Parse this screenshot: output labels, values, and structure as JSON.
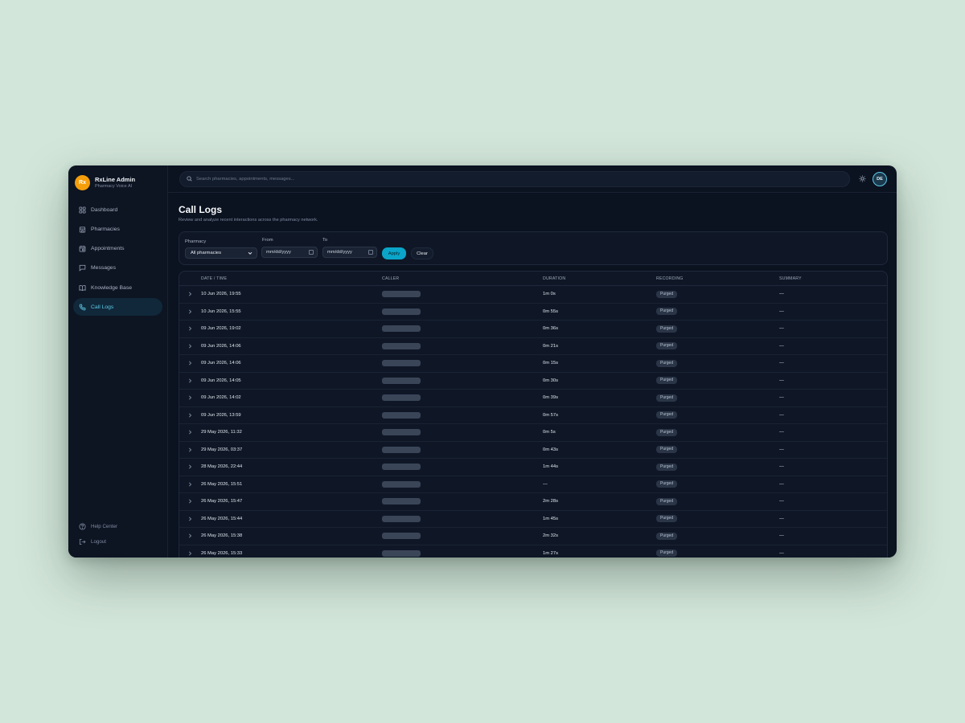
{
  "brand": {
    "logo": "Rx",
    "name": "RxLine Admin",
    "subtitle": "Pharmacy Voice AI"
  },
  "nav": [
    {
      "label": "Dashboard",
      "icon": "grid-icon",
      "active": false
    },
    {
      "label": "Pharmacies",
      "icon": "building-icon",
      "active": false
    },
    {
      "label": "Appointments",
      "icon": "calendar-icon",
      "active": false
    },
    {
      "label": "Messages",
      "icon": "message-icon",
      "active": false
    },
    {
      "label": "Knowledge Base",
      "icon": "book-icon",
      "active": false
    },
    {
      "label": "Call Logs",
      "icon": "phone-icon",
      "active": true
    }
  ],
  "nav_bottom": [
    {
      "label": "Help Center",
      "icon": "help-icon"
    },
    {
      "label": "Logout",
      "icon": "logout-icon"
    }
  ],
  "topbar": {
    "search_placeholder": "Search pharmacies, appointments, messages...",
    "avatar": "DE"
  },
  "page": {
    "title": "Call Logs",
    "subtitle": "Review and analyze recent interactions across the pharmacy network."
  },
  "filters": {
    "pharmacy_label": "Pharmacy",
    "pharmacy_value": "All pharmacies",
    "from_label": "From",
    "from_value": "mm/dd/yyyy",
    "to_label": "To",
    "to_value": "mm/dd/yyyy",
    "apply_label": "Apply",
    "clear_label": "Clear"
  },
  "table": {
    "columns": [
      "DATE / TIME",
      "CALLER",
      "DURATION",
      "RECORDING",
      "SUMMARY"
    ],
    "rows": [
      {
        "date": "10 Jun 2026, 19:55",
        "duration": "1m 0s",
        "recording": "Purged",
        "summary": "—"
      },
      {
        "date": "10 Jun 2026, 15:55",
        "duration": "0m 55s",
        "recording": "Purged",
        "summary": "—"
      },
      {
        "date": "09 Jun 2026, 19:02",
        "duration": "0m 36s",
        "recording": "Purged",
        "summary": "—"
      },
      {
        "date": "09 Jun 2026, 14:06",
        "duration": "0m 21s",
        "recording": "Purged",
        "summary": "—"
      },
      {
        "date": "09 Jun 2026, 14:06",
        "duration": "0m 15s",
        "recording": "Purged",
        "summary": "—"
      },
      {
        "date": "09 Jun 2026, 14:05",
        "duration": "0m 30s",
        "recording": "Purged",
        "summary": "—"
      },
      {
        "date": "09 Jun 2026, 14:02",
        "duration": "0m 39s",
        "recording": "Purged",
        "summary": "—"
      },
      {
        "date": "09 Jun 2026, 13:59",
        "duration": "0m 57s",
        "recording": "Purged",
        "summary": "—"
      },
      {
        "date": "29 May 2026, 11:32",
        "duration": "0m 5s",
        "recording": "Purged",
        "summary": "—"
      },
      {
        "date": "29 May 2026, 03:37",
        "duration": "0m 43s",
        "recording": "Purged",
        "summary": "—"
      },
      {
        "date": "28 May 2026, 22:44",
        "duration": "1m 44s",
        "recording": "Purged",
        "summary": "—"
      },
      {
        "date": "26 May 2026, 15:51",
        "duration": "—",
        "recording": "Purged",
        "summary": "—"
      },
      {
        "date": "26 May 2026, 15:47",
        "duration": "2m 28s",
        "recording": "Purged",
        "summary": "—"
      },
      {
        "date": "26 May 2026, 15:44",
        "duration": "1m 45s",
        "recording": "Purged",
        "summary": "—"
      },
      {
        "date": "26 May 2026, 15:38",
        "duration": "2m 32s",
        "recording": "Purged",
        "summary": "—"
      },
      {
        "date": "26 May 2026, 15:33",
        "duration": "1m 27s",
        "recording": "Purged",
        "summary": "—"
      }
    ]
  }
}
